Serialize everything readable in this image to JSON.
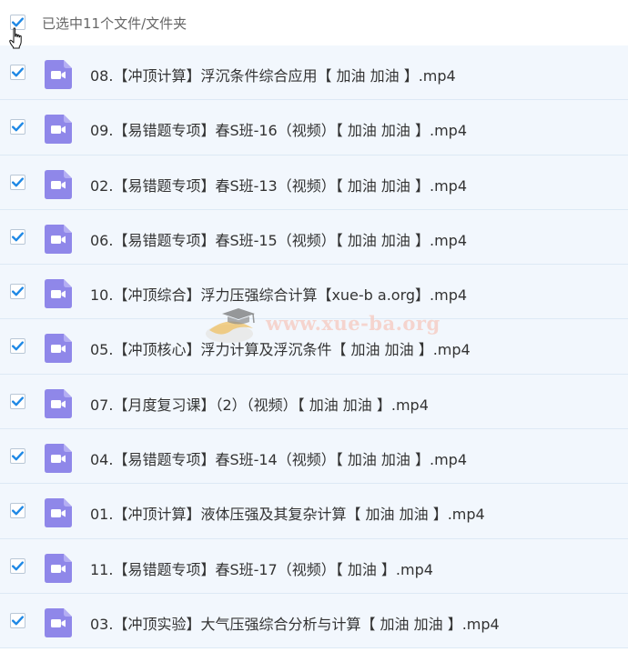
{
  "header": {
    "select_all_checked": true,
    "selection_label": "已选中11个文件/文件夹"
  },
  "files": [
    {
      "name": "08.【冲顶计算】浮沉条件综合应用【 加油 加油 】.mp4",
      "checked": true
    },
    {
      "name": "09.【易错题专项】春S班-16（视频）【 加油 加油 】.mp4",
      "checked": true
    },
    {
      "name": "02.【易错题专项】春S班-13（视频）【 加油 加油 】.mp4",
      "checked": true
    },
    {
      "name": "06.【易错题专项】春S班-15（视频）【 加油 加油 】.mp4",
      "checked": true
    },
    {
      "name": "10.【冲顶综合】浮力压强综合计算【xue-b a.org】.mp4",
      "checked": true
    },
    {
      "name": "05.【冲顶核心】浮力计算及浮沉条件【 加油 加油 】.mp4",
      "checked": true
    },
    {
      "name": "07.【月度复习课】（2）（视频）【 加油 加油 】.mp4",
      "checked": true
    },
    {
      "name": "04.【易错题专项】春S班-14（视频）【 加油 加油 】.mp4",
      "checked": true
    },
    {
      "name": "01.【冲顶计算】液体压强及其复杂计算【 加油 加油 】.mp4",
      "checked": true
    },
    {
      "name": "11.【易错题专项】春S班-17（视频）【 加油 】.mp4",
      "checked": true
    },
    {
      "name": "03.【冲顶实验】大气压强综合分析与计算【 加油 加油 】.mp4",
      "checked": true
    }
  ],
  "watermark": {
    "text": "www.xue-ba.org"
  },
  "colors": {
    "check": "#1e88e5",
    "row_bg": "#f2f7fd",
    "row_border": "#dde9f5",
    "video_icon": "#8f87e9",
    "text": "#333333",
    "label": "#666666"
  },
  "icons": {
    "file_type": "video-file-icon",
    "checkbox": "checkmark-icon",
    "cursor": "hand-pointer-icon"
  }
}
